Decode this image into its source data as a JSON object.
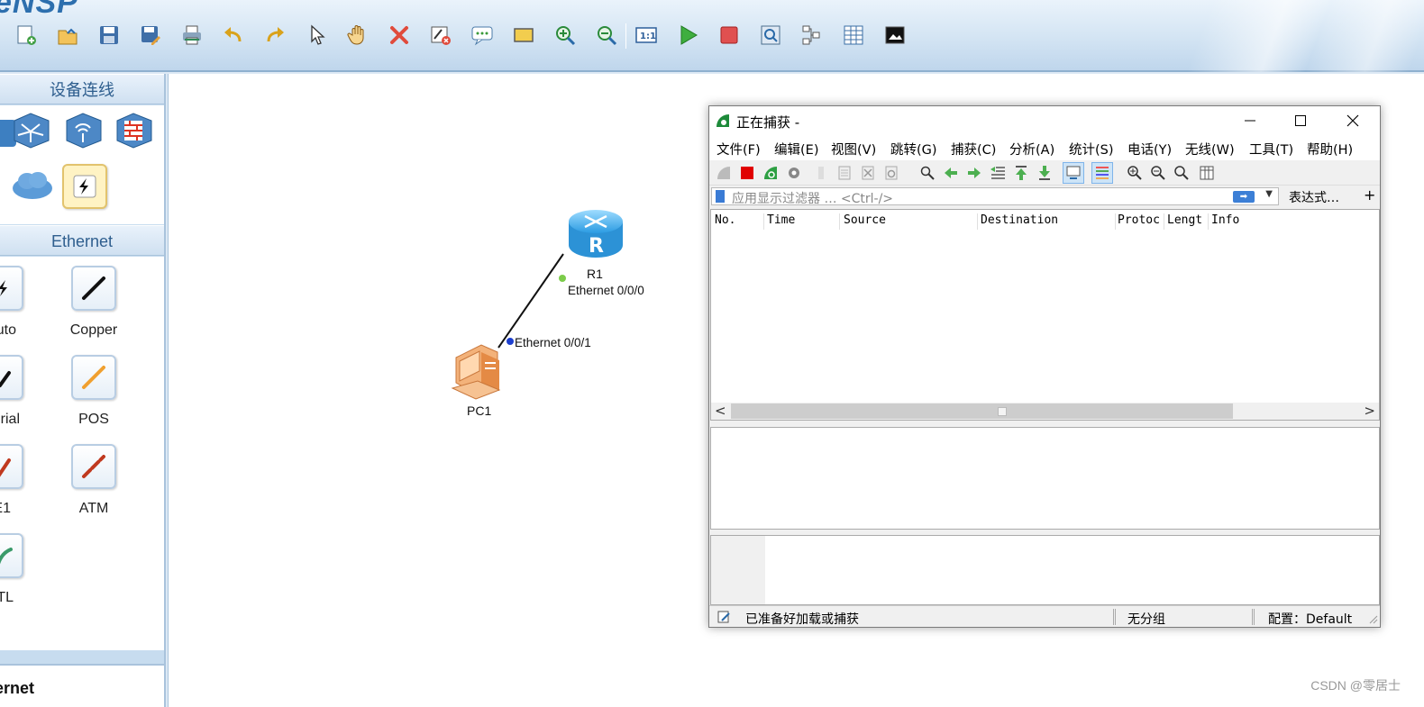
{
  "ensp": {
    "brand": "eNSP",
    "toolbar": [
      {
        "icon": "new-topology-icon"
      },
      {
        "icon": "open-icon"
      },
      {
        "icon": "save-icon"
      },
      {
        "icon": "save-as-icon"
      },
      {
        "icon": "print-icon"
      },
      {
        "icon": "undo-icon"
      },
      {
        "icon": "redo-icon"
      },
      {
        "icon": "select-pointer-icon"
      },
      {
        "icon": "pan-hand-icon"
      },
      {
        "icon": "delete-icon"
      },
      {
        "icon": "delete-all-icon"
      },
      {
        "icon": "text-comment-icon"
      },
      {
        "icon": "rectangle-icon"
      },
      {
        "icon": "zoom-in-icon"
      },
      {
        "icon": "zoom-out-icon"
      },
      {
        "icon": "fit-1to1-icon"
      },
      {
        "icon": "start-devices-icon"
      },
      {
        "icon": "stop-devices-icon"
      },
      {
        "icon": "capture-icon"
      },
      {
        "icon": "topology-icon"
      },
      {
        "icon": "grid-icon"
      },
      {
        "icon": "screenshot-icon"
      }
    ]
  },
  "left_panel": {
    "header": "设备连线",
    "section_header": "Ethernet",
    "connections": [
      {
        "label": "uto"
      },
      {
        "label": "Copper"
      },
      {
        "label": "rial"
      },
      {
        "label": "POS"
      },
      {
        "label": "E1"
      },
      {
        "label": "ATM"
      },
      {
        "label": "TL"
      }
    ],
    "bottom_title": "ernet"
  },
  "topology": {
    "router": {
      "name": "R1",
      "port": "Ethernet 0/0/0"
    },
    "pc": {
      "name": "PC1",
      "port": "Ethernet 0/0/1"
    }
  },
  "wireshark": {
    "title": "正在捕获 -",
    "menu": [
      "文件(F)",
      "编辑(E)",
      "视图(V)",
      "跳转(G)",
      "捕获(C)",
      "分析(A)",
      "统计(S)",
      "电话(Y)",
      "无线(W)",
      "工具(T)",
      "帮助(H)"
    ],
    "filter_placeholder": "应用显示过滤器 … <Ctrl-/>",
    "expression_label": "表达式…",
    "plus_label": "+",
    "columns": [
      "No.",
      "Time",
      "Source",
      "Destination",
      "Protoc",
      "Lengt",
      "Info"
    ],
    "status": {
      "ready": "已准备好加载或捕获",
      "packets": "无分组",
      "profile": "配置：Default"
    }
  },
  "watermark": "CSDN @零居士"
}
